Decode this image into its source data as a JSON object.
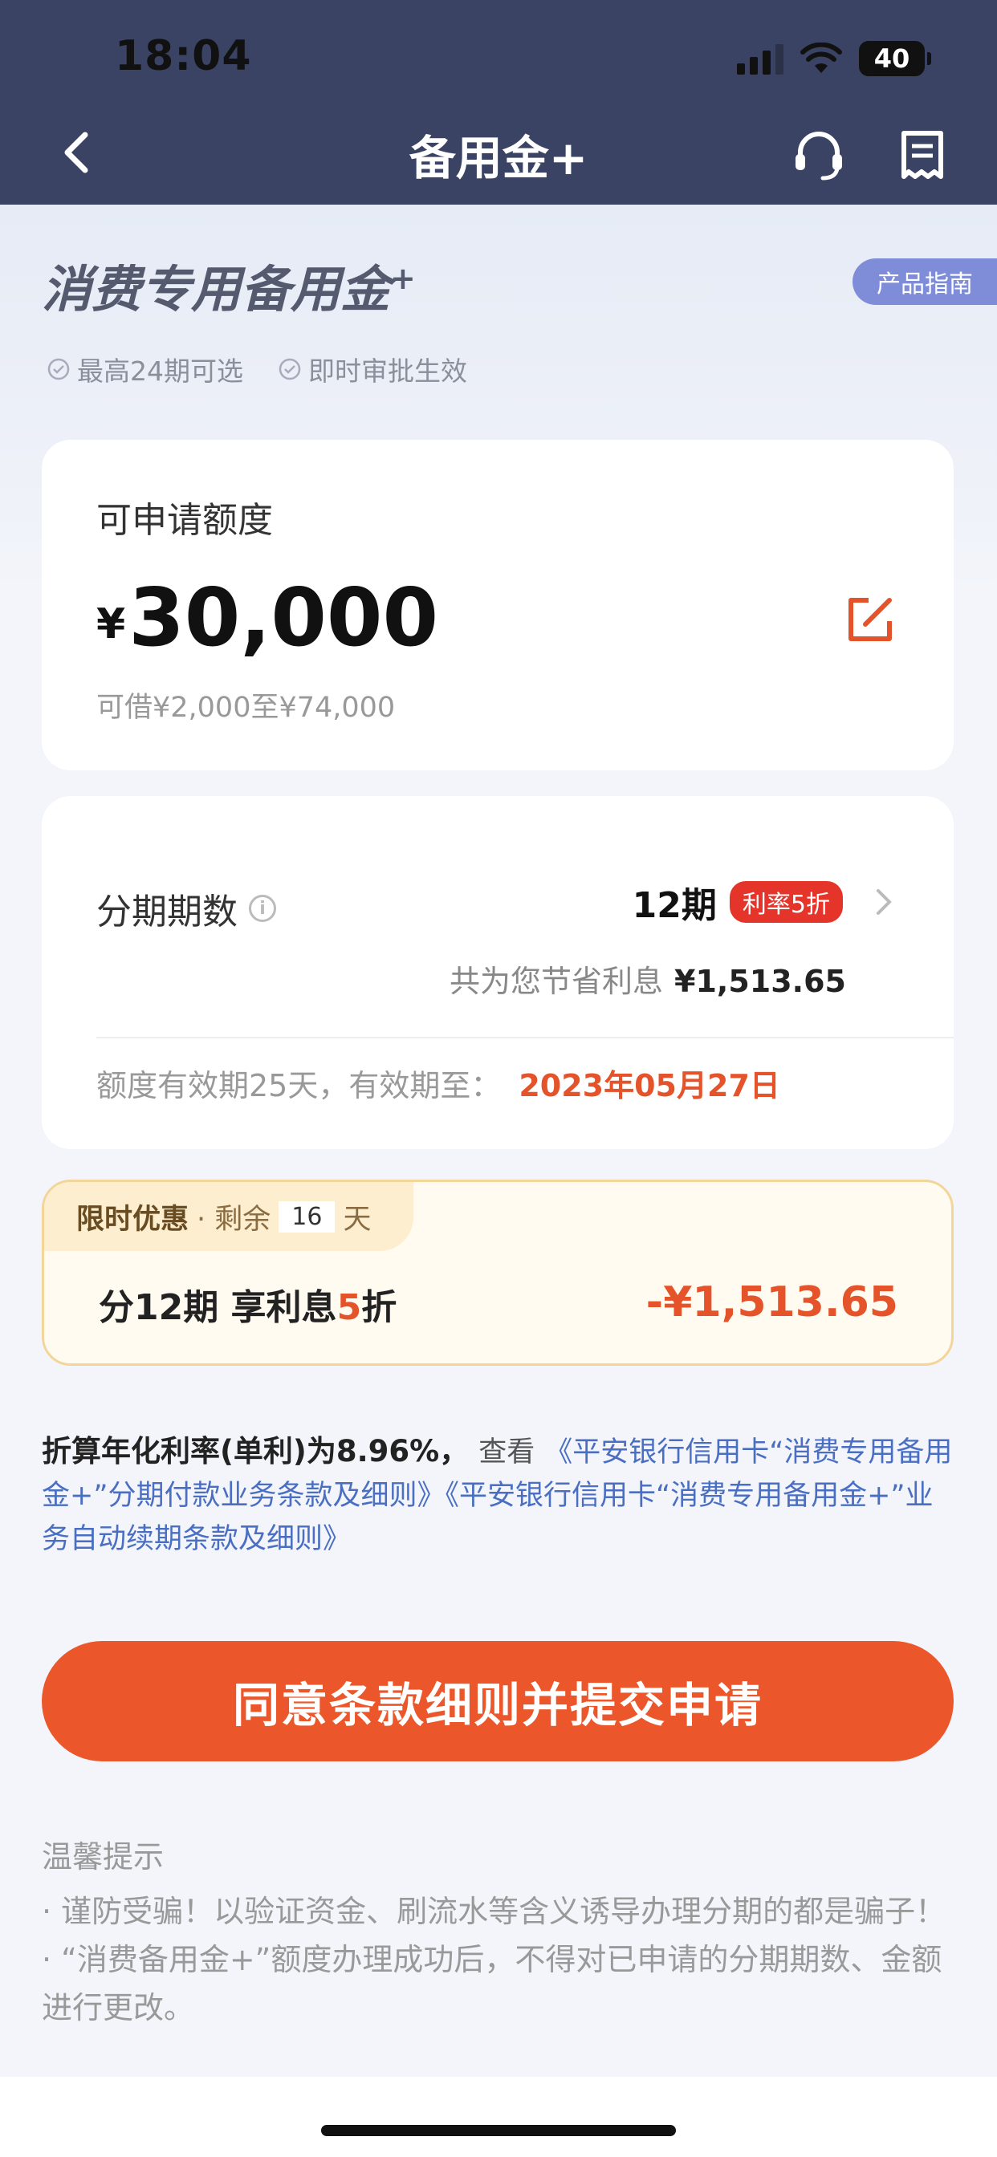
{
  "status_bar": {
    "time": "18:04",
    "battery": "40"
  },
  "nav": {
    "title": "备用金+"
  },
  "hero": {
    "title": "消费专用备用金",
    "title_sup": "+",
    "guide_label": "产品指南",
    "features": [
      "最高24期可选",
      "即时审批生效"
    ]
  },
  "quota": {
    "label": "可申请额度",
    "currency": "¥",
    "amount": "30,000",
    "range": "可借¥2,000至¥74,000"
  },
  "term": {
    "label": "分期期数",
    "periods": "12期",
    "rate_badge": "利率5折",
    "save_text": "共为您节省利息",
    "save_amount": "¥1,513.65",
    "valid_text": "额度有效期25天，有效期至：",
    "valid_date": "2023年05月27日"
  },
  "promo": {
    "tag": "限时优惠",
    "remaining_prefix": "· 剩余",
    "days": "16",
    "days_unit": "天",
    "line_prefix": "分12期 享利息",
    "line_highlight": "5",
    "line_suffix": "折",
    "amount": "-¥1,513.65"
  },
  "terms": {
    "rate_text": "折算年化利率(单利)为8.96%，",
    "look_text": "查看",
    "link1": "《平安银行信用卡“消费专用备用金+”分期付款业务条款及细则》",
    "link2": "《平安银行信用卡“消费专用备用金+”业务自动续期条款及细则》"
  },
  "submit_label": "同意条款细则并提交申请",
  "tips": {
    "title": "温馨提示",
    "items": [
      "· 谨防受骗！以验证资金、刷流水等含义诱导办理分期的都是骗子！",
      "· “消费备用金+”额度办理成功后，不得对已申请的分期期数、金额进行更改。"
    ]
  },
  "colors": {
    "nav_bg": "#3a4363",
    "accent": "#eb572a",
    "link": "#4a6fc2",
    "badge": "#e5352b"
  }
}
